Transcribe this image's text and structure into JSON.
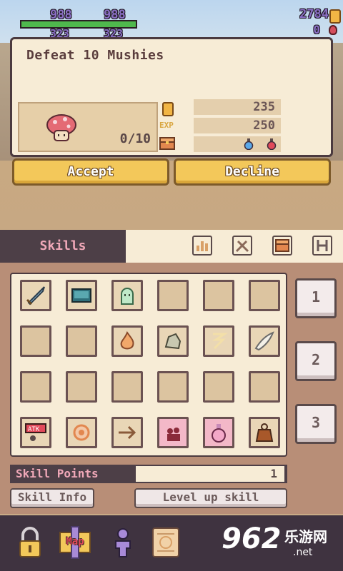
{
  "hud": {
    "hp_left": "988",
    "hp_right": "988",
    "hp_fraction": 1.0,
    "mp_left": "323",
    "mp_right": "323",
    "gold": "2784",
    "gems": "0"
  },
  "quest": {
    "title": "Defeat 10 Mushies",
    "progress": "0/10",
    "exp_label": "EXP",
    "reward_gold": "235",
    "reward_exp": "250",
    "accept_label": "Accept",
    "decline_label": "Decline"
  },
  "tabs": {
    "active_label": "Skills",
    "icons": [
      "stats-icon",
      "weapon-icon",
      "chest-icon",
      "menu-h-icon"
    ]
  },
  "skills": {
    "slots": [
      "sword-icon",
      "book-icon",
      "ghost-icon",
      "",
      "",
      "",
      "",
      "",
      "fire-icon",
      "rock-icon",
      "whirlwind-icon",
      "wing-icon",
      "",
      "",
      "",
      "",
      "",
      "",
      "atk-up-icon",
      "gear-icon",
      "arrow-icon",
      "shadow-icon",
      "potion-icon",
      "bag-icon"
    ],
    "pages": [
      "1",
      "2",
      "3"
    ],
    "points_label": "Skill Points",
    "points_value": "1",
    "info_label": "Skill Info",
    "levelup_label": "Level up skill"
  },
  "bottom_bar": {
    "items": [
      "lock-icon",
      "map-icon",
      "character-icon",
      "scroll-icon"
    ],
    "map_text": "Map"
  },
  "watermark": {
    "number": "962",
    "chinese": "乐游网",
    "domain": ".net"
  },
  "colors": {
    "accent_gold": "#f3c85a",
    "panel_bg": "#f7ecd6",
    "dark_panel": "#4d3f47",
    "pink_text": "#f0a8b8"
  }
}
